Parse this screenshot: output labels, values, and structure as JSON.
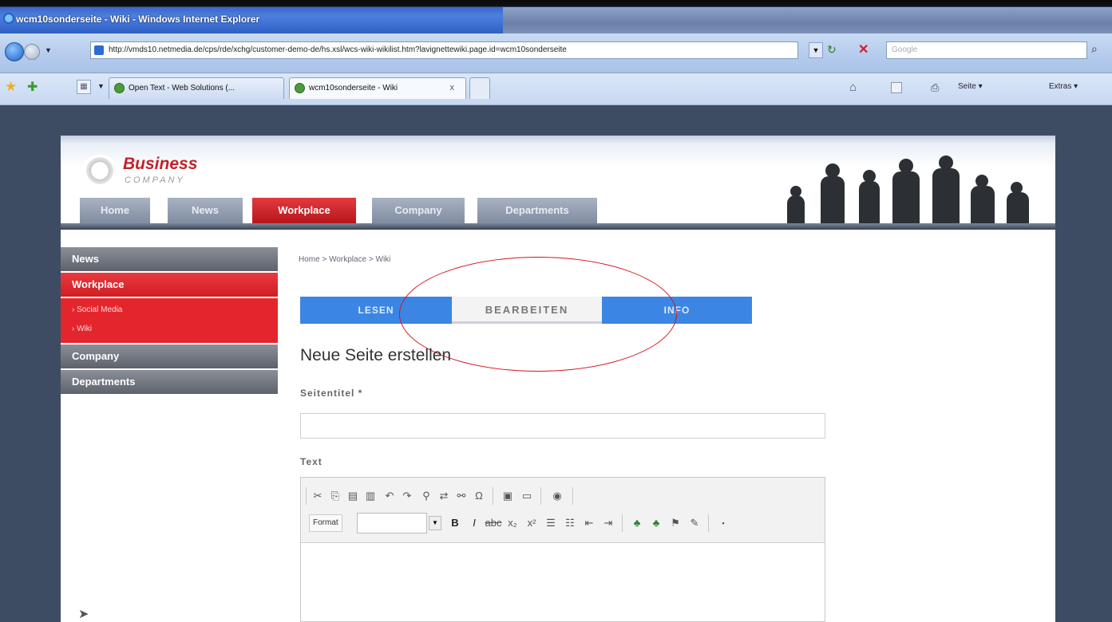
{
  "browser": {
    "window_title": "wcm10sonderseite - Wiki - Windows Internet Explorer",
    "url": "http://vmds10.netmedia.de/cps/rde/xchg/customer-demo-de/hs.xsl/wcs-wiki-wikilist.htm?lavignettewiki.page.id=wcm10sonderseite",
    "search_placeholder": "Google",
    "tabs": [
      {
        "label": "Open Text - Web Solutions (..."
      },
      {
        "label": "wcm10sonderseite - Wiki",
        "close": "x"
      }
    ],
    "commands": {
      "page": "Seite ▾",
      "tools": "Extras ▾"
    }
  },
  "site": {
    "logo": {
      "name": "Business",
      "sub": "COMPANY"
    },
    "topnav": [
      {
        "label": "Home"
      },
      {
        "label": "News"
      },
      {
        "label": "Workplace",
        "active": true
      },
      {
        "label": "Company"
      },
      {
        "label": "Departments"
      }
    ],
    "sidebar": {
      "news": "News",
      "workplace": "Workplace",
      "sub": [
        "› Social Media",
        "› Wiki"
      ],
      "company": "Company",
      "departments": "Departments"
    },
    "breadcrumb": "Home  >  Workplace  >  Wiki",
    "wiki_tabs": {
      "read": "LESEN",
      "edit": "BEARBEITEN",
      "info": "INFO"
    },
    "form": {
      "heading": "Neue Seite erstellen",
      "title_label": "Seitentitel *",
      "title_value": "",
      "text_label": "Text",
      "format_label": "Format"
    }
  },
  "colors": {
    "accent_red": "#d4141b",
    "tab_blue": "#3b86e4",
    "sidebar_grey": "#6b7079"
  }
}
